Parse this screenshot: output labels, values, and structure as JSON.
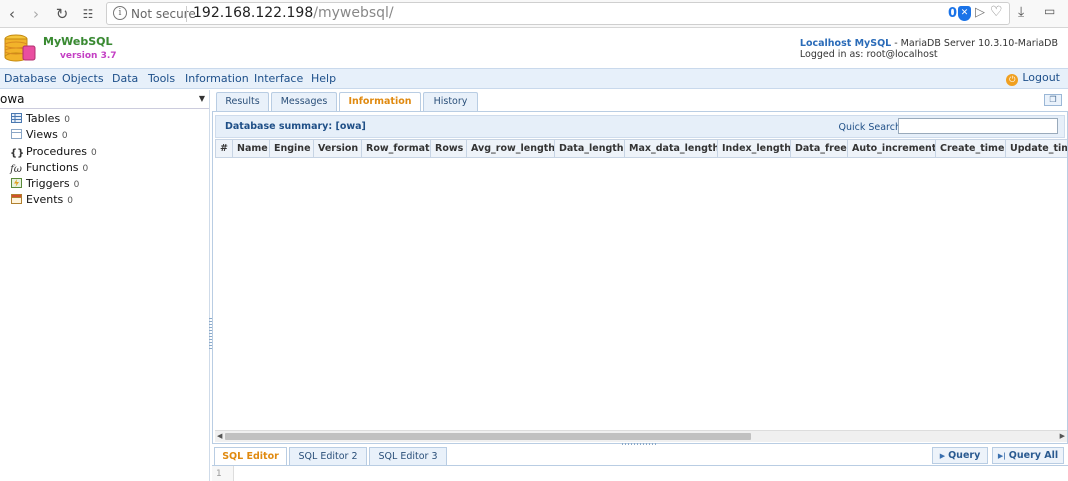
{
  "browser": {
    "security": "Not secure",
    "url_host": "192.168.122.198",
    "url_path": "/mywebsql/",
    "ext_count": "0"
  },
  "app": {
    "name": "MyWebSQL",
    "version": "version 3.7",
    "server_link": "Localhost MySQL",
    "server_desc": " - MariaDB Server 10.3.10-MariaDB",
    "logged_in": "Logged in as: root@localhost"
  },
  "menu": {
    "items": [
      "Database",
      "Objects",
      "Data",
      "Tools",
      "Information",
      "Interface",
      "Help"
    ],
    "logout": "Logout"
  },
  "sidebar": {
    "database": "owa",
    "items": [
      {
        "label": "Tables",
        "count": "0",
        "icon": "table-icon"
      },
      {
        "label": "Views",
        "count": "0",
        "icon": "view-icon"
      },
      {
        "label": "Procedures",
        "count": "0",
        "icon": "procedure-icon"
      },
      {
        "label": "Functions",
        "count": "0",
        "icon": "function-icon"
      },
      {
        "label": "Triggers",
        "count": "0",
        "icon": "trigger-icon"
      },
      {
        "label": "Events",
        "count": "0",
        "icon": "event-icon"
      }
    ]
  },
  "tabs": [
    "Results",
    "Messages",
    "Information",
    "History"
  ],
  "summary": {
    "title": "Database summary: [owa]",
    "quick_search": "Quick Search",
    "columns": [
      "#",
      "Name",
      "Engine",
      "Version",
      "Row_format",
      "Rows",
      "Avg_row_length",
      "Data_length",
      "Max_data_length",
      "Index_length",
      "Data_free",
      "Auto_increment",
      "Create_time",
      "Update_time"
    ]
  },
  "editor": {
    "tabs": [
      "SQL Editor",
      "SQL Editor 2",
      "SQL Editor 3"
    ],
    "query": "Query",
    "query_all": "Query All",
    "line": "1"
  }
}
